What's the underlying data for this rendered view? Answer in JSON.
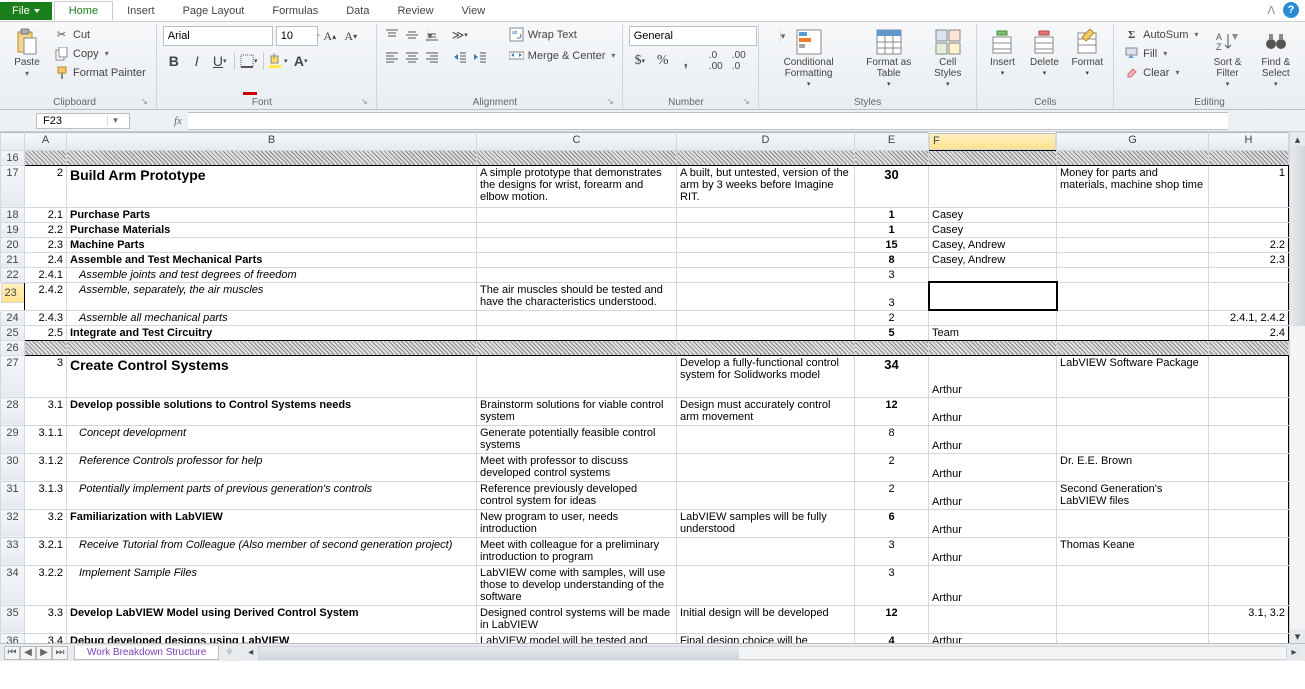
{
  "tabs": {
    "file": "File",
    "home": "Home",
    "insert": "Insert",
    "pagelayout": "Page Layout",
    "formulas": "Formulas",
    "data": "Data",
    "review": "Review",
    "view": "View"
  },
  "clipboard": {
    "paste": "Paste",
    "cut": "Cut",
    "copy": "Copy",
    "fmt": "Format Painter",
    "group": "Clipboard"
  },
  "font": {
    "name": "Arial",
    "size": "10",
    "group": "Font"
  },
  "align": {
    "wrap": "Wrap Text",
    "merge": "Merge & Center",
    "group": "Alignment"
  },
  "number": {
    "fmt": "General",
    "group": "Number"
  },
  "styles": {
    "cond": "Conditional Formatting",
    "table": "Format as Table",
    "cell": "Cell Styles",
    "group": "Styles"
  },
  "cells": {
    "insert": "Insert",
    "delete": "Delete",
    "format": "Format",
    "group": "Cells"
  },
  "editing": {
    "sum": "AutoSum",
    "fill": "Fill",
    "clear": "Clear",
    "sort": "Sort & Filter",
    "find": "Find & Select",
    "group": "Editing"
  },
  "namebox": "F23",
  "cols": {
    "A": "A",
    "B": "B",
    "C": "C",
    "D": "D",
    "E": "E",
    "F": "F",
    "G": "G",
    "H": "H"
  },
  "rows": {
    "17": {
      "n": "17",
      "a": "2",
      "b": "Build Arm Prototype",
      "c": "A simple prototype that demonstrates the designs for wrist, forearm and elbow motion.",
      "d": "A built, but untested, version of the arm by 3 weeks before Imagine RIT.",
      "e": "30",
      "g": "Money for parts and materials, machine shop time",
      "h": "1"
    },
    "18": {
      "n": "18",
      "a": "2.1",
      "b": "Purchase Parts",
      "e": "1",
      "f": "Casey"
    },
    "19": {
      "n": "19",
      "a": "2.2",
      "b": "Purchase Materials",
      "e": "1",
      "f": "Casey"
    },
    "20": {
      "n": "20",
      "a": "2.3",
      "b": "Machine Parts",
      "e": "15",
      "f": "Casey, Andrew",
      "h": "2.2"
    },
    "21": {
      "n": "21",
      "a": "2.4",
      "b": "Assemble and Test Mechanical Parts",
      "e": "8",
      "f": "Casey, Andrew",
      "h": "2.3"
    },
    "22": {
      "n": "22",
      "a": "2.4.1",
      "b": "Assemble joints and test degrees of freedom",
      "e": "3"
    },
    "23": {
      "n": "23",
      "a": "2.4.2",
      "b": "Assemble, separately, the air muscles",
      "c": "The air muscles should be tested and have the characteristics understood.",
      "e": "3"
    },
    "24": {
      "n": "24",
      "a": "2.4.3",
      "b": "Assemble all mechanical parts",
      "e": "2",
      "h": "2.4.1, 2.4.2"
    },
    "25": {
      "n": "25",
      "a": "2.5",
      "b": "Integrate and Test Circuitry",
      "e": "5",
      "f": "Team",
      "h": "2.4"
    },
    "27": {
      "n": "27",
      "a": "3",
      "b": "Create Control Systems",
      "d": "Develop a fully-functional control system for Solidworks model",
      "e": "34",
      "f": "Arthur",
      "g": "LabVIEW Software Package"
    },
    "28": {
      "n": "28",
      "a": "3.1",
      "b": "Develop possible solutions to Control Systems needs",
      "c": "Brainstorm solutions for viable control system",
      "d": "Design must accurately control arm movement",
      "e": "12",
      "f": "Arthur"
    },
    "29": {
      "n": "29",
      "a": "3.1.1",
      "b": "Concept development",
      "c": "Generate potentially feasible control systems",
      "e": "8",
      "f": "Arthur"
    },
    "30": {
      "n": "30",
      "a": "3.1.2",
      "b": "Reference Controls professor for help",
      "c": "Meet with professor to discuss developed control systems",
      "e": "2",
      "f": "Arthur",
      "g": "Dr. E.E. Brown"
    },
    "31": {
      "n": "31",
      "a": "3.1.3",
      "b": "Potentially implement parts of previous generation's controls",
      "c": "Reference previously developed control system for ideas",
      "e": "2",
      "f": "Arthur",
      "g": "Second Generation's LabVIEW files"
    },
    "32": {
      "n": "32",
      "a": "3.2",
      "b": "Familiarization with LabVIEW",
      "c": "New program to user, needs introduction",
      "d": "LabVIEW samples will be fully understood",
      "e": "6",
      "f": "Arthur"
    },
    "33": {
      "n": "33",
      "a": "3.2.1",
      "b": "Receive Tutorial from Colleague (Also member of second generation project)",
      "c": "Meet with colleague for a preliminary introduction to program",
      "e": "3",
      "f": "Arthur",
      "g": "Thomas Keane"
    },
    "34": {
      "n": "34",
      "a": "3.2.2",
      "b": "Implement Sample Files",
      "c": "LabVIEW come with samples, will use those to develop understanding of the software",
      "e": "3",
      "f": "Arthur"
    },
    "35": {
      "n": "35",
      "a": "3.3",
      "b": "Develop LabVIEW Model using Derived Control System",
      "c": "Designed control systems will be made in LabVIEW",
      "d": "Initial design will be developed",
      "e": "12",
      "h": "3.1, 3.2"
    },
    "36": {
      "n": "36",
      "a": "3.4",
      "b": "Debug developed designs using LabVIEW",
      "c": "LabVIEW model will be tested and modified",
      "d": "Final design choice will be debugged via LabVIEW",
      "e": "4",
      "f": "Arthur"
    }
  },
  "sheet": "Work Breakdown Structure"
}
